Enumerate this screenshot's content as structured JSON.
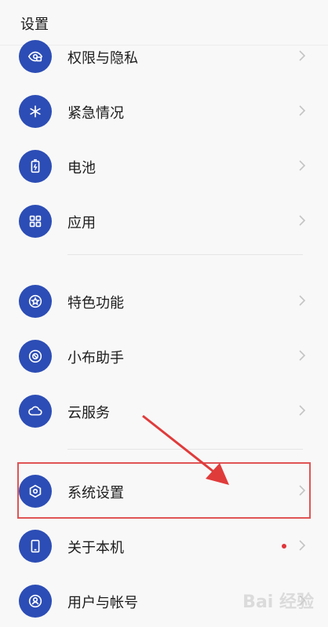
{
  "header": {
    "title": "设置"
  },
  "items": [
    {
      "label": "权限与隐私",
      "icon": "privacy-icon"
    },
    {
      "label": "紧急情况",
      "icon": "emergency-icon"
    },
    {
      "label": "电池",
      "icon": "battery-icon"
    },
    {
      "label": "应用",
      "icon": "apps-grid-icon"
    },
    {
      "label": "特色功能",
      "icon": "star-icon"
    },
    {
      "label": "小布助手",
      "icon": "assistant-icon"
    },
    {
      "label": "云服务",
      "icon": "cloud-icon"
    },
    {
      "label": "系统设置",
      "icon": "hexagon-settings-icon"
    },
    {
      "label": "关于本机",
      "icon": "phone-icon"
    },
    {
      "label": "用户与帐号",
      "icon": "user-icon"
    }
  ],
  "colors": {
    "icon_bg": "#2c4db5",
    "highlight": "#e05454",
    "notification_dot": "#e0353b"
  },
  "watermark": "Bai 经验"
}
